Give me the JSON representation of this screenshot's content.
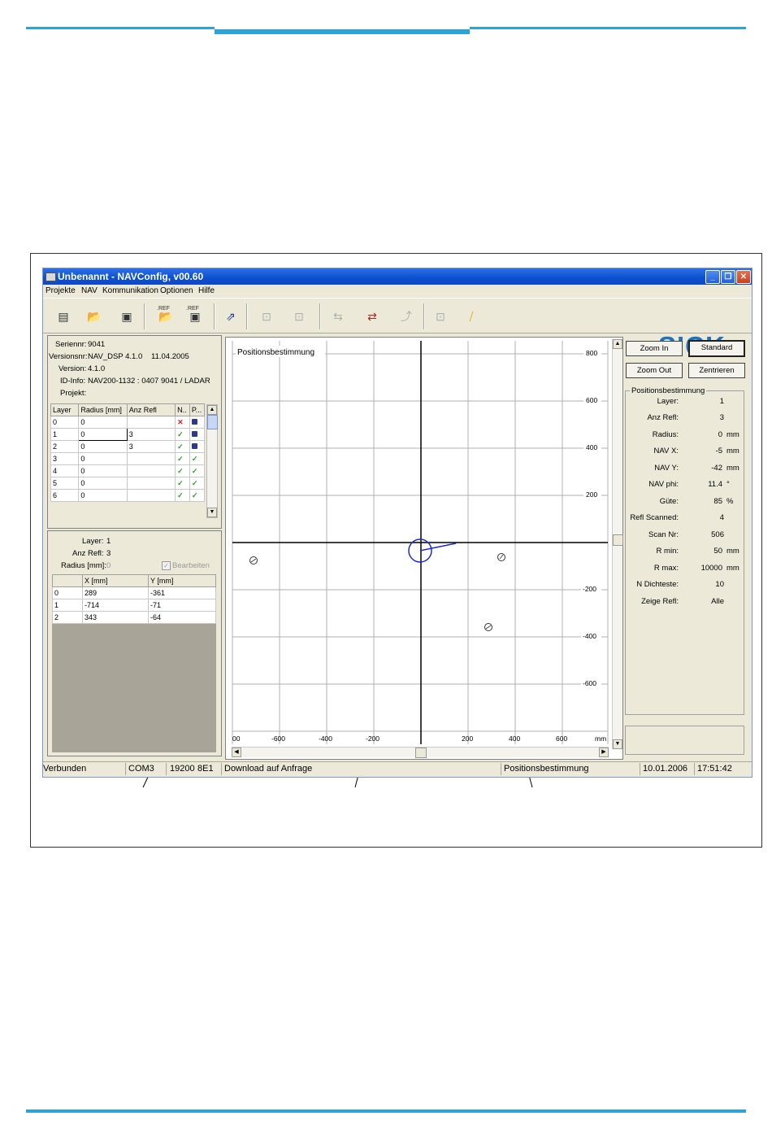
{
  "window": {
    "title": "Unbenannt - NAVConfig, v00.60",
    "icon": "app-icon",
    "controls": [
      "minimize-icon",
      "maximize-icon",
      "close-icon"
    ]
  },
  "menu": [
    "Projekte",
    "NAV",
    "Kommunikation",
    "Optionen",
    "Hilfe"
  ],
  "toolbar": {
    "icons": [
      "new-project-icon",
      "open-folder-icon",
      "save-icon",
      "open-ref-icon",
      "save-ref-icon",
      "download-icon",
      "upload-device-icon",
      "download-device-icon",
      "transfer-icon",
      "exchange-icon",
      "send-icon",
      "connect-icon",
      "disconnect-icon"
    ],
    "ref_label": ".REF",
    "logo": "SICK"
  },
  "info": {
    "serial_label": "Seriennr:",
    "serial": "9041",
    "version_no_label": "Versionsnr:",
    "version_no": "NAV_DSP 4.1.0",
    "version_date": "11.04.2005",
    "version_label": "Version:",
    "version": "4.1.0",
    "id_label": "ID-Info:",
    "id": "NAV200-1132 : 0407 9041 / LADAR",
    "project_label": "Projekt:"
  },
  "layer_table": {
    "headers": [
      "Layer",
      "Radius [mm]",
      "Anz Refl",
      "N..",
      "P..."
    ],
    "rows": [
      {
        "layer": "0",
        "radius": "0",
        "anz": "",
        "n": "x",
        "p": "disk"
      },
      {
        "layer": "1",
        "radius": "0",
        "anz": "3",
        "n": "check",
        "p": "disk"
      },
      {
        "layer": "2",
        "radius": "0",
        "anz": "3",
        "n": "check",
        "p": "disk"
      },
      {
        "layer": "3",
        "radius": "0",
        "anz": "",
        "n": "check",
        "p": "check"
      },
      {
        "layer": "4",
        "radius": "0",
        "anz": "",
        "n": "check",
        "p": "check"
      },
      {
        "layer": "5",
        "radius": "0",
        "anz": "",
        "n": "check",
        "p": "check"
      },
      {
        "layer": "6",
        "radius": "0",
        "anz": "",
        "n": "check",
        "p": "check"
      }
    ]
  },
  "layer_detail": {
    "layer_label": "Layer:",
    "layer": "1",
    "anz_label": "Anz Refl:",
    "anz": "3",
    "radius_label": "Radius [mm]:",
    "radius": "0",
    "edit_label": "Bearbeiten",
    "headers": [
      "",
      "X [mm]",
      "Y [mm]"
    ],
    "rows": [
      {
        "i": "0",
        "x": "289",
        "y": "-361"
      },
      {
        "i": "1",
        "x": "-714",
        "y": "-71"
      },
      {
        "i": "2",
        "x": "343",
        "y": "-64"
      }
    ]
  },
  "plot": {
    "title": "Positionsbestimmung",
    "y_ticks": [
      "800",
      "600",
      "400",
      "200",
      "-200",
      "-400",
      "-600"
    ],
    "x_ticks": [
      "00",
      "-600",
      "-400",
      "-200",
      "200",
      "400",
      "600",
      "mm"
    ]
  },
  "buttons": {
    "zoom_in": "Zoom In",
    "standard": "Standard",
    "zoom_out": "Zoom Out",
    "center": "Zentrieren"
  },
  "position": {
    "group_title": "Positionsbestimmung",
    "rows": [
      {
        "label": "Layer:",
        "value": "1",
        "unit": ""
      },
      {
        "label": "Anz Refl:",
        "value": "3",
        "unit": ""
      },
      {
        "label": "Radius:",
        "value": "0",
        "unit": "mm"
      },
      {
        "label": "NAV X:",
        "value": "-5",
        "unit": "mm"
      },
      {
        "label": "NAV Y:",
        "value": "-42",
        "unit": "mm"
      },
      {
        "label": "NAV phi:",
        "value": "11.4",
        "unit": "°"
      },
      {
        "label": "Güte:",
        "value": "85",
        "unit": "%"
      },
      {
        "label": "Refl Scanned:",
        "value": "4",
        "unit": ""
      },
      {
        "label": "Scan Nr:",
        "value": "506",
        "unit": ""
      },
      {
        "label": "R min:",
        "value": "50",
        "unit": "mm"
      },
      {
        "label": "R max:",
        "value": "10000",
        "unit": "mm"
      },
      {
        "label": "N Dichteste:",
        "value": "10",
        "unit": ""
      },
      {
        "label": "Zeige Refl:",
        "value": "Alle",
        "unit": ""
      }
    ]
  },
  "status": {
    "connection": "Verbunden",
    "port": "COM3",
    "baud": "19200",
    "format": "8E1",
    "mode": "Download auf Anfrage",
    "view": "Positionsbestimmung",
    "date": "10.01.2006",
    "time": "17:51:42"
  },
  "colors": {
    "accent_rule": "#2ea4d6",
    "title_bar": "#0a4fd0",
    "logo": "#1e73be",
    "vehicle": "#1a2bd8"
  }
}
